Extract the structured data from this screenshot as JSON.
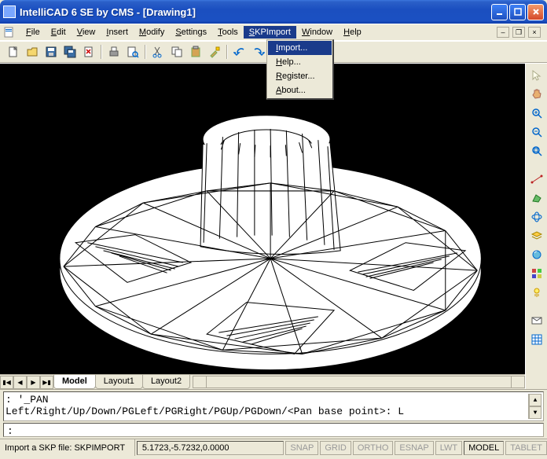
{
  "title": "IntelliCAD 6 SE by CMS - [Drawing1]",
  "menubar": {
    "items": [
      {
        "label": "File",
        "accel": "F"
      },
      {
        "label": "Edit",
        "accel": "E"
      },
      {
        "label": "View",
        "accel": "V"
      },
      {
        "label": "Insert",
        "accel": "I"
      },
      {
        "label": "Modify",
        "accel": "M"
      },
      {
        "label": "Settings",
        "accel": "S"
      },
      {
        "label": "Tools",
        "accel": "T"
      },
      {
        "label": "SKPImport",
        "accel": "S",
        "active": true
      },
      {
        "label": "Window",
        "accel": "W"
      },
      {
        "label": "Help",
        "accel": "H"
      }
    ]
  },
  "dropdown": {
    "items": [
      {
        "label": "Import...",
        "hl": true
      },
      {
        "label": "Help...",
        "hl": false
      },
      {
        "label": "Register...",
        "hl": false
      },
      {
        "label": "About...",
        "hl": false
      }
    ]
  },
  "toolbar": {
    "icons": [
      "new",
      "open",
      "save",
      "saveall",
      "close",
      "print",
      "preview",
      "cut",
      "copy",
      "paste",
      "match",
      "undo",
      "redo"
    ]
  },
  "sidebar": {
    "icons": [
      "select",
      "pan",
      "zoom-in",
      "zoom-out",
      "zoom-ext",
      "dist",
      "area",
      "orbit",
      "layers",
      "render",
      "mat",
      "light",
      "view",
      "grid"
    ]
  },
  "tabs": {
    "nav": [
      "|◀",
      "◀",
      "▶",
      "▶|"
    ],
    "items": [
      {
        "label": "Model",
        "active": true
      },
      {
        "label": "Layout1",
        "active": false
      },
      {
        "label": "Layout2",
        "active": false
      }
    ]
  },
  "command": {
    "history_line1": ": '_PAN",
    "history_line2": "Left/Right/Up/Down/PGLeft/PGRight/PGUp/PGDown/<Pan base point>: L",
    "prompt": ":"
  },
  "status": {
    "hint": "Import a SKP file: SKPIMPORT",
    "coords": "5.1723,-5.7232,0.0000",
    "toggles": [
      {
        "label": "SNAP",
        "on": false
      },
      {
        "label": "GRID",
        "on": false
      },
      {
        "label": "ORTHO",
        "on": false
      },
      {
        "label": "ESNAP",
        "on": false
      },
      {
        "label": "LWT",
        "on": false
      },
      {
        "label": "MODEL",
        "on": true
      },
      {
        "label": "TABLET",
        "on": false
      }
    ]
  }
}
